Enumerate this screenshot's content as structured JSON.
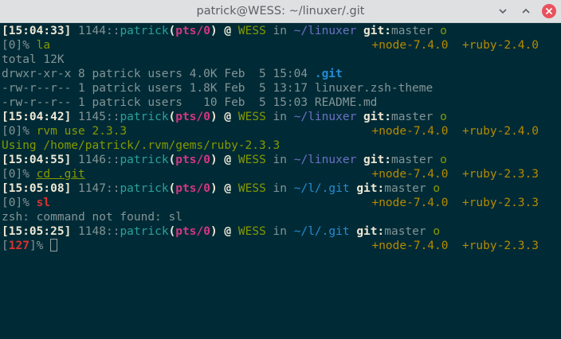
{
  "window": {
    "title": "patrick@WESS: ~/linuxer/.git"
  },
  "prompts": [
    {
      "time": "15:04:33",
      "hist": "1144",
      "user": "patrick",
      "tty": "pts/0",
      "host": "WESS",
      "in": "in",
      "path": "~/linuxer",
      "git_label": "git:",
      "branch": "master",
      "status": "o",
      "node": "+node-7.4.0",
      "ruby": "+ruby-2.4.0",
      "code": "0",
      "cmd": "la"
    },
    {
      "time": "15:04:42",
      "hist": "1145",
      "user": "patrick",
      "tty": "pts/0",
      "host": "WESS",
      "in": "in",
      "path": "~/linuxer",
      "git_label": "git:",
      "branch": "master",
      "status": "o",
      "node": "+node-7.4.0",
      "ruby": "+ruby-2.4.0",
      "code": "0",
      "cmd": "rvm use 2.3.3"
    },
    {
      "time": "15:04:55",
      "hist": "1146",
      "user": "patrick",
      "tty": "pts/0",
      "host": "WESS",
      "in": "in",
      "path": "~/linuxer",
      "git_label": "git:",
      "branch": "master",
      "status": "o",
      "node": "+node-7.4.0",
      "ruby": "+ruby-2.3.3",
      "code": "0",
      "cmd": "cd .git"
    },
    {
      "time": "15:05:08",
      "hist": "1147",
      "user": "patrick",
      "tty": "pts/0",
      "host": "WESS",
      "in": "in",
      "path": "~/l/.git",
      "git_label": "git:",
      "branch": "master",
      "status": "o",
      "node": "+node-7.4.0",
      "ruby": "+ruby-2.3.3",
      "code": "0",
      "cmd": "sl"
    },
    {
      "time": "15:05:25",
      "hist": "1148",
      "user": "patrick",
      "tty": "pts/0",
      "host": "WESS",
      "in": "in",
      "path": "~/l/.git",
      "git_label": "git:",
      "branch": "master",
      "status": "o",
      "node": "+node-7.4.0",
      "ruby": "+ruby-2.3.3",
      "code": "127",
      "cmd": ""
    }
  ],
  "outputs": {
    "la": {
      "total": "total 12K",
      "rows": [
        {
          "meta": "drwxr-xr-x 8 patrick users 4.0K Feb  5 15:04 ",
          "name": ".git"
        },
        {
          "meta": "-rw-r--r-- 1 patrick users 1.8K Feb  5 13:17 ",
          "name": "linuxer.zsh-theme"
        },
        {
          "meta": "-rw-r--r-- 1 patrick users   10 Feb  5 15:03 ",
          "name": "README.md"
        }
      ]
    },
    "rvm": "Using /home/patrick/.rvm/gems/ruby-2.3.3",
    "sl": "zsh: command not found: sl"
  },
  "colors": {
    "background": "#002b36",
    "text": "#839496",
    "time": "#eee8d5",
    "user": "#2aa198",
    "tty": "#d33682",
    "host": "#859900",
    "path_full": "#6c71c4",
    "path_short": "#268bd2",
    "git_label": "#eee8d5",
    "status": "#859900",
    "env": "#b58900",
    "error_code": "#dc322f",
    "dir": "#268bd2"
  },
  "icons": {
    "minimize": "minimize-icon",
    "maximize": "maximize-icon",
    "close": "close-icon"
  }
}
